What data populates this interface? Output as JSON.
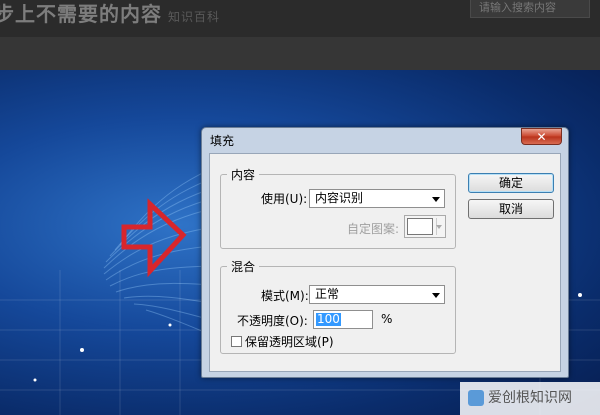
{
  "top": {
    "title": "步上不需要的内容",
    "subtitle": "知识百科",
    "search_placeholder": "请输入搜索内容"
  },
  "dialog": {
    "title": "填充",
    "close_glyph": "✕",
    "content_group": {
      "legend": "内容",
      "use_label": "使用(U):",
      "use_value": "内容识别",
      "pattern_label": "自定图案:"
    },
    "blend_group": {
      "legend": "混合",
      "mode_label": "模式(M):",
      "mode_value": "正常",
      "opacity_label": "不透明度(O):",
      "opacity_value": "100",
      "opacity_unit": "%",
      "preserve_label": "保留透明区域(P)"
    },
    "ok_label": "确定",
    "cancel_label": "取消"
  },
  "watermark": {
    "text": "爱创根知识网"
  },
  "colors": {
    "arrow": "#d8262c",
    "background_blue": "#15489a",
    "selection": "#3399ff"
  }
}
